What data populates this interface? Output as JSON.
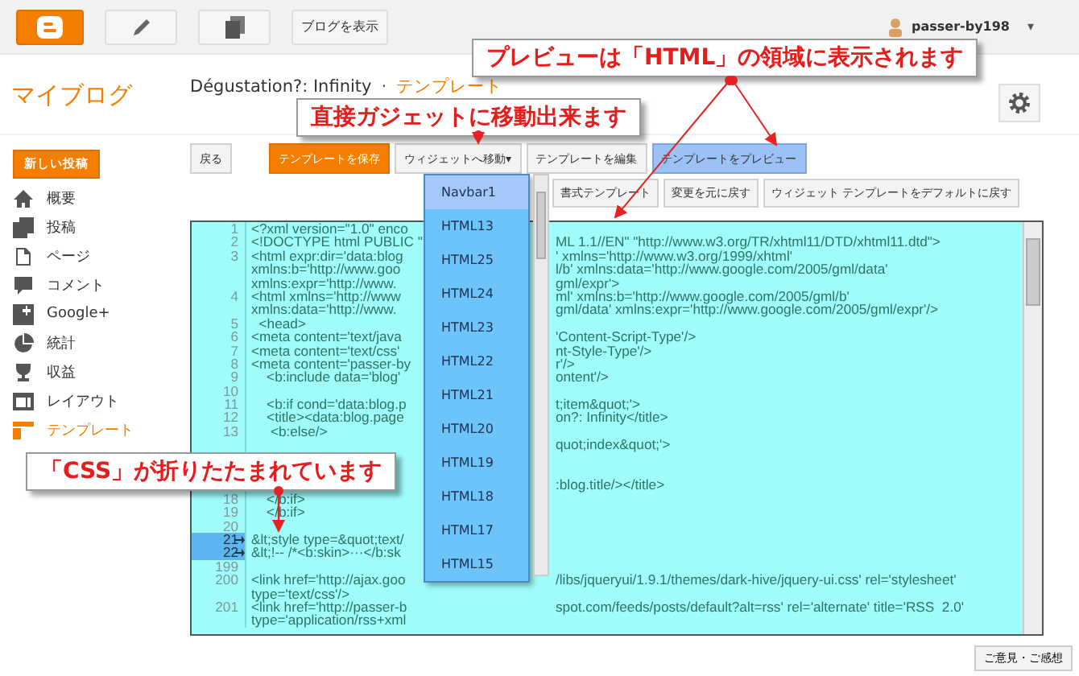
{
  "topbar": {
    "view_blog": "ブログを表示",
    "user": "passer-by198",
    "caret": "▾"
  },
  "header": {
    "app_title": "マイブログ",
    "blog_name": "Dégustation?: Infinity",
    "separator": "·",
    "page": "テンプレート"
  },
  "sidebar": {
    "new_post": "新しい投稿",
    "items": [
      {
        "label": "概要",
        "selected": false
      },
      {
        "label": "投稿",
        "selected": false
      },
      {
        "label": "ページ",
        "selected": false
      },
      {
        "label": "コメント",
        "selected": false
      },
      {
        "label": "Google+",
        "selected": false
      },
      {
        "label": "統計",
        "selected": false
      },
      {
        "label": "収益",
        "selected": false
      },
      {
        "label": "レイアウト",
        "selected": false
      },
      {
        "label": "テンプレート",
        "selected": true
      }
    ]
  },
  "toolbar": [
    {
      "label": "戻る",
      "kind": "plain"
    },
    {
      "label": "テンプレートを保存",
      "kind": "primary"
    },
    {
      "label": "ウィジェットへ移動",
      "kind": "menu",
      "caret": "▾"
    },
    {
      "label": "テンプレートを編集",
      "kind": "plain"
    },
    {
      "label": "テンプレートをプレビュー",
      "kind": "active"
    }
  ],
  "toolbar_2": [
    "書式テンプレート",
    "変更を元に戻す",
    "ウィジェット テンプレートをデフォルトに戻す"
  ],
  "widget_menu": [
    {
      "label": "Navbar1",
      "selected": true
    },
    {
      "label": "HTML13",
      "selected": false
    },
    {
      "label": "HTML25",
      "selected": false
    },
    {
      "label": "HTML24",
      "selected": false
    },
    {
      "label": "HTML23",
      "selected": false
    },
    {
      "label": "HTML22",
      "selected": false
    },
    {
      "label": "HTML21",
      "selected": false
    },
    {
      "label": "HTML20",
      "selected": false
    },
    {
      "label": "HTML19",
      "selected": false
    },
    {
      "label": "HTML18",
      "selected": false
    },
    {
      "label": "HTML17",
      "selected": false
    },
    {
      "label": "HTML15",
      "selected": false
    }
  ],
  "code_rows": [
    {
      "num": "1",
      "left": "<?xml version=\"1.0\" enco",
      "right": "",
      "folded": false
    },
    {
      "num": "2",
      "left": "<!DOCTYPE html PUBLIC \"",
      "right": "ML 1.1//EN\" \"http://www.w3.org/TR/xhtml11/DTD/xhtml11.dtd\">",
      "folded": false
    },
    {
      "num": "3",
      "left": "<html expr:dir='data:blog",
      "right": "' xmlns='http://www.w3.org/1999/xhtml'",
      "folded": false
    },
    {
      "num": "",
      "left": "xmlns:b='http://www.goo",
      "right": "l/b' xmlns:data='http://www.google.com/2005/gml/data'",
      "folded": false
    },
    {
      "num": "",
      "left": "xmlns:expr='http://www.",
      "right": "gml/expr'>",
      "folded": false
    },
    {
      "num": "4",
      "left": "<html xmlns='http://www",
      "right": "ml' xmlns:b='http://www.google.com/2005/gml/b'",
      "folded": false
    },
    {
      "num": "",
      "left": "xmlns:data='http://www.",
      "right": "gml/data' xmlns:expr='http://www.google.com/2005/gml/expr'/>",
      "folded": false
    },
    {
      "num": "5",
      "left": "  <head>",
      "right": "",
      "folded": false
    },
    {
      "num": "6",
      "left": "<meta content='text/java",
      "right": "'Content-Script-Type'/>",
      "folded": false
    },
    {
      "num": "7",
      "left": "<meta content='text/css'",
      "right": "nt-Style-Type'/>",
      "folded": false
    },
    {
      "num": "8",
      "left": "<meta content='passer-by",
      "right": "r'/>",
      "folded": false
    },
    {
      "num": "9",
      "left": "    <b:include data='blog'",
      "right": "ontent'/>",
      "folded": false
    },
    {
      "num": "10",
      "left": "",
      "right": "",
      "folded": false
    },
    {
      "num": "11",
      "left": "    <b:if cond='data:blog.p",
      "right": "t;item&quot;'>",
      "folded": false
    },
    {
      "num": "12",
      "left": "    <title><data:blog.page",
      "right": "on?: Infinity</title>",
      "folded": false
    },
    {
      "num": "13",
      "left": "     <b:else/>",
      "right": "",
      "folded": false
    },
    {
      "num": "",
      "left": "",
      "right": "quot;index&quot;'>"
    },
    {
      "num": "",
      "left": "",
      "right": ""
    },
    {
      "num": "",
      "left": "",
      "right": ""
    },
    {
      "num": "",
      "left": "",
      "right": ":blog.title/></title>"
    },
    {
      "num": "18",
      "left": "    </b:if>",
      "right": "",
      "folded": false
    },
    {
      "num": "19",
      "left": "    </b:if>",
      "right": "",
      "folded": false
    },
    {
      "num": "20",
      "left": "",
      "right": "",
      "folded": false
    },
    {
      "num": "21",
      "left": "&lt;style type=&quot;text/",
      "right": "",
      "folded": true
    },
    {
      "num": "22",
      "left": "&lt;!-- /*<b:skin>···</b:sk",
      "right": "",
      "folded": true
    },
    {
      "num": "199",
      "left": "",
      "right": "",
      "folded": false
    },
    {
      "num": "200",
      "left": "<link href='http://ajax.goo",
      "right": "/libs/jqueryui/1.9.1/themes/dark-hive/jquery-ui.css' rel='stylesheet'",
      "folded": false
    },
    {
      "num": "",
      "left": "type='text/css'/>",
      "right": "",
      "folded": false
    },
    {
      "num": "201",
      "left": "<link href='http://passer-b",
      "right": "spot.com/feeds/posts/default?alt=rss' rel='alternate' title='RSS  2.0'",
      "folded": false
    },
    {
      "num": "",
      "left": "type='application/rss+xml",
      "right": "",
      "folded": false
    }
  ],
  "callouts": [
    {
      "text": "プレビューは「HTML」の領域に表示されます"
    },
    {
      "text": "直接ガジェットに移動出来ます"
    },
    {
      "text": "「CSS」が折りたたまれています"
    }
  ],
  "feedback": "ご意見・ご感想"
}
